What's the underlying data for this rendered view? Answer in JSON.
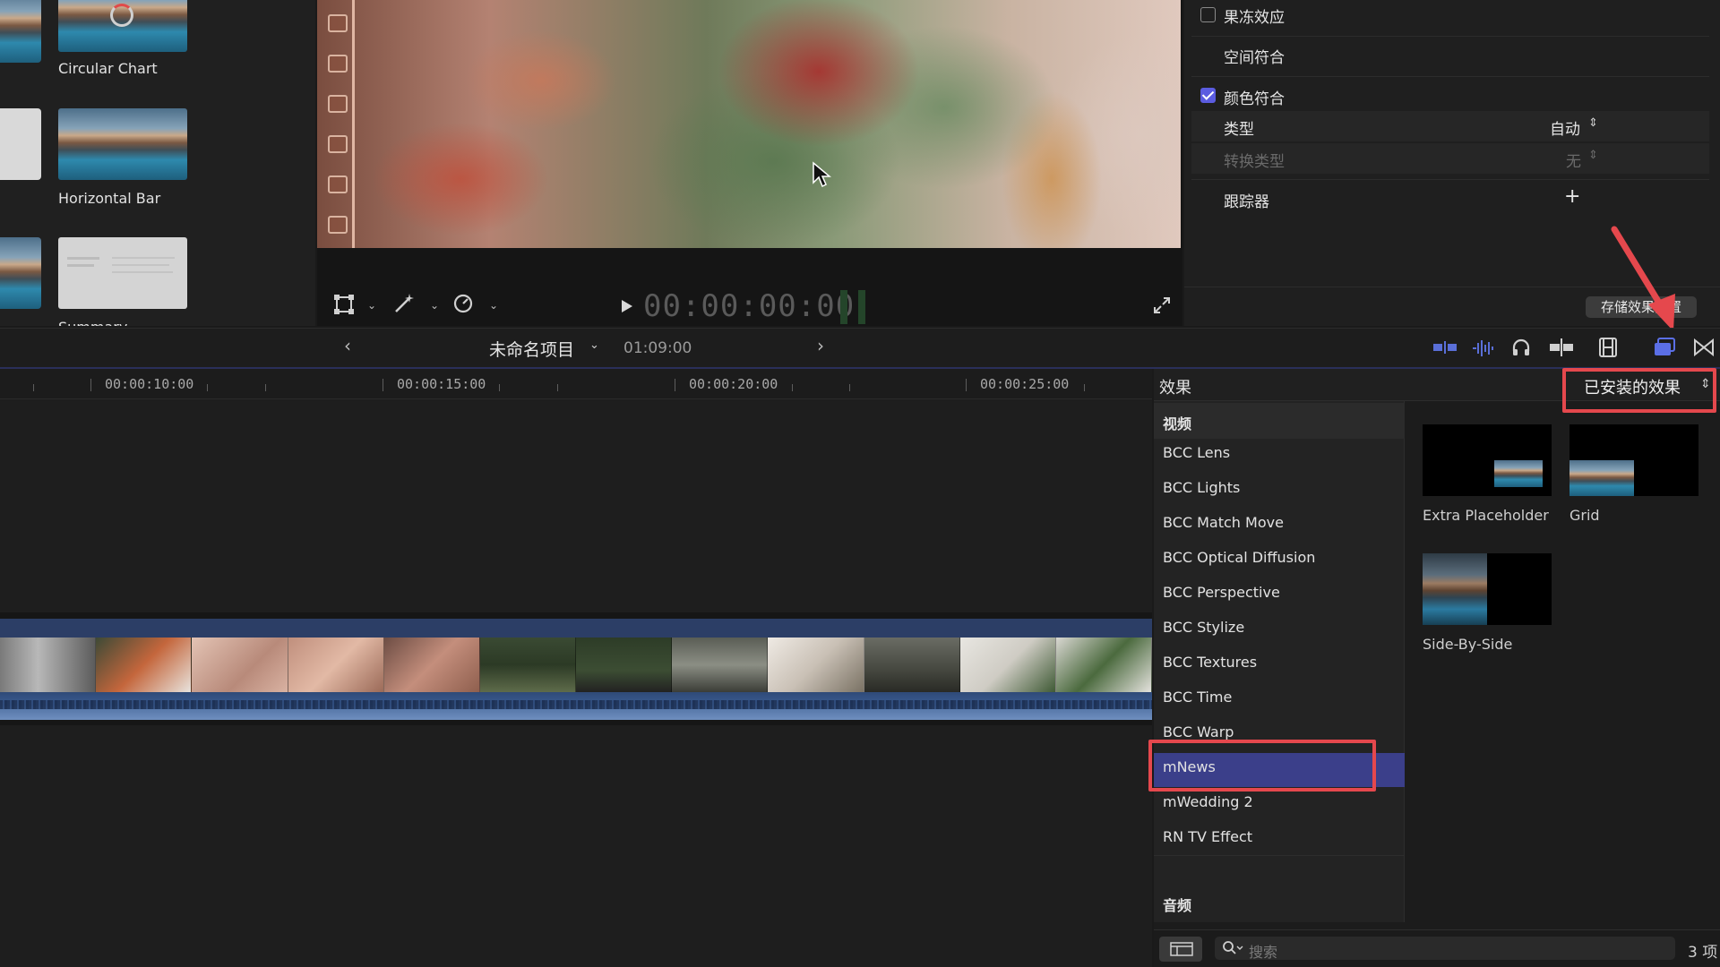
{
  "browser": {
    "items": [
      {
        "label": "Circular Chart"
      },
      {
        "label": "Horizontal Bar"
      },
      {
        "label": "Summary"
      }
    ]
  },
  "viewer": {
    "timecode": "00:00:00:00"
  },
  "inspector": {
    "freeze_frame_label": "果冻效应",
    "spatial_conform_label": "空间符合",
    "color_conform_label": "颜色符合",
    "type_label": "类型",
    "type_value": "自动",
    "convert_label": "转换类型",
    "convert_value": "无",
    "tracker_label": "跟踪器",
    "tracker_add": "+",
    "store_button": "存储效果预置"
  },
  "timeline_toolbar": {
    "project_name": "未命名项目",
    "duration": "01:09:00"
  },
  "ruler": {
    "labels": [
      "00:00:10:00",
      "00:00:15:00",
      "00:00:20:00",
      "00:00:25:00"
    ]
  },
  "effects": {
    "title": "效果",
    "filter": "已安装的效果",
    "category_video": "视频",
    "items": [
      "BCC Lens",
      "BCC Lights",
      "BCC Match Move",
      "BCC Optical Diffusion",
      "BCC Perspective",
      "BCC Stylize",
      "BCC Textures",
      "BCC Time",
      "BCC Warp",
      "mNews",
      "mWedding 2",
      "RN TV Effect"
    ],
    "category_audio": "音频",
    "thumbs": [
      "Extra Placeholder",
      "Grid",
      "Side-By-Side"
    ],
    "search_placeholder": "搜索",
    "count": "3 项"
  },
  "colors": {
    "accent": "#5b5ce0",
    "selection": "#3b3f8a",
    "annotation_red": "#e5484d"
  }
}
